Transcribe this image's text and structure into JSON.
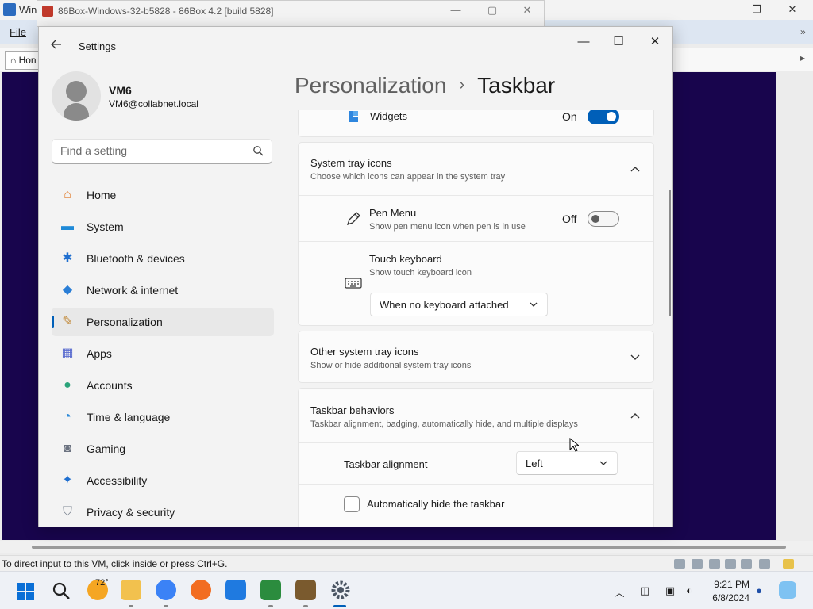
{
  "host": {
    "title": "Win",
    "menu_file": "File",
    "tab_label": "Hon",
    "status_text": "To direct input to this VM, click inside or press Ctrl+G."
  },
  "bg_window": {
    "title": "86Box-Windows-32-b5828 - 86Box 4.2 [build 5828]"
  },
  "settings": {
    "title": "Settings",
    "profile": {
      "name": "VM6",
      "email": "VM6@collabnet.local"
    },
    "search": {
      "placeholder": "Find a setting"
    },
    "nav": [
      {
        "label": "Home",
        "icon": "home-icon",
        "selected": false
      },
      {
        "label": "System",
        "icon": "system-icon",
        "selected": false
      },
      {
        "label": "Bluetooth & devices",
        "icon": "bluetooth-icon",
        "selected": false
      },
      {
        "label": "Network & internet",
        "icon": "wifi-icon",
        "selected": false
      },
      {
        "label": "Personalization",
        "icon": "brush-icon",
        "selected": true
      },
      {
        "label": "Apps",
        "icon": "apps-icon",
        "selected": false
      },
      {
        "label": "Accounts",
        "icon": "person-icon",
        "selected": false
      },
      {
        "label": "Time & language",
        "icon": "globe-clock-icon",
        "selected": false
      },
      {
        "label": "Gaming",
        "icon": "gamepad-icon",
        "selected": false
      },
      {
        "label": "Accessibility",
        "icon": "accessibility-icon",
        "selected": false
      },
      {
        "label": "Privacy & security",
        "icon": "shield-icon",
        "selected": false
      }
    ],
    "breadcrumb": {
      "parent": "Personalization",
      "separator": "›",
      "current": "Taskbar"
    },
    "widgets": {
      "label": "Widgets",
      "state": "On"
    },
    "system_tray": {
      "title": "System tray icons",
      "subtitle": "Choose which icons can appear in the system tray",
      "pen_menu": {
        "label": "Pen Menu",
        "desc": "Show pen menu icon when pen is in use",
        "state": "Off"
      },
      "touch_keyboard": {
        "label": "Touch keyboard",
        "desc": "Show touch keyboard icon",
        "option": "When no keyboard attached"
      }
    },
    "other_tray": {
      "title": "Other system tray icons",
      "subtitle": "Show or hide additional system tray icons"
    },
    "behaviors": {
      "title": "Taskbar behaviors",
      "subtitle": "Taskbar alignment, badging, automatically hide, and multiple displays",
      "alignment_label": "Taskbar alignment",
      "alignment_value": "Left",
      "autohide_label": "Automatically hide the taskbar"
    }
  },
  "taskbar": {
    "weather_temp": "72°",
    "clock_time": "9:21 PM",
    "clock_date": "6/8/2024"
  },
  "colors": {
    "accent": "#005fb8",
    "vm_background": "#18054d"
  }
}
